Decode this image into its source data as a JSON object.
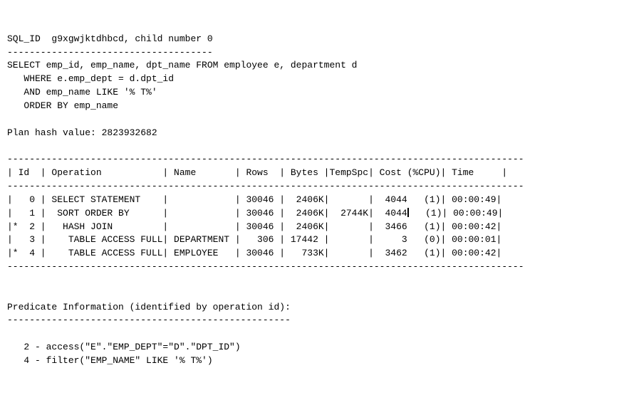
{
  "header": {
    "sql_id_line": "SQL_ID  g9xgwjktdhbcd, child number 0",
    "sep1": "-------------------------------------",
    "stmt_l1": "SELECT emp_id, emp_name, dpt_name FROM employee e, department d",
    "stmt_l2": "   WHERE e.emp_dept = d.dpt_id",
    "stmt_l3": "   AND emp_name LIKE '% T%'",
    "stmt_l4": "   ORDER BY emp_name",
    "plan_hash": "Plan hash value: 2823932682"
  },
  "table": {
    "hr": "---------------------------------------------------------------------------------------------",
    "cols": "| Id  | Operation           | Name       | Rows  | Bytes |TempSpc| Cost (%CPU)| Time     |",
    "r0": "|   0 | SELECT STATEMENT    |            | 30046 |  2406K|       |  4044   (1)| 00:00:49|",
    "r1": "|   1 |  SORT ORDER BY      |            | 30046 |  2406K|  2744K|  4044",
    "r1_tail": "   (1)| 00:00:49|",
    "r2": "|*  2 |   HASH JOIN         |            | 30046 |  2406K|       |  3466   (1)| 00:00:42|",
    "r3": "|   3 |    TABLE ACCESS FULL| DEPARTMENT |   306 | 17442 |       |     3   (0)| 00:00:01|",
    "r4": "|*  4 |    TABLE ACCESS FULL| EMPLOYEE   | 30046 |   733K|       |  3462   (1)| 00:00:42|"
  },
  "predicates": {
    "title": "Predicate Information (identified by operation id):",
    "sep": "---------------------------------------------------",
    "p2": "   2 - access(\"E\".\"EMP_DEPT\"=\"D\".\"DPT_ID\")",
    "p4": "   4 - filter(\"EMP_NAME\" LIKE '% T%')"
  },
  "chart_data": {
    "type": "table",
    "title": "Oracle SQL Execution Plan",
    "sql_id": "g9xgwjktdhbcd",
    "child_number": 0,
    "sql_text": "SELECT emp_id, emp_name, dpt_name FROM employee e, department d WHERE e.emp_dept = d.dpt_id AND emp_name LIKE '% T%' ORDER BY emp_name",
    "plan_hash_value": 2823932682,
    "columns": [
      "Id",
      "Operation",
      "Name",
      "Rows",
      "Bytes",
      "TempSpc",
      "Cost (%CPU)",
      "Time"
    ],
    "rows": [
      {
        "Id": 0,
        "Operation": "SELECT STATEMENT",
        "Name": "",
        "Rows": 30046,
        "Bytes": "2406K",
        "TempSpc": "",
        "Cost": 4044,
        "%CPU": 1,
        "Time": "00:00:49"
      },
      {
        "Id": 1,
        "Operation": "SORT ORDER BY",
        "Name": "",
        "Rows": 30046,
        "Bytes": "2406K",
        "TempSpc": "2744K",
        "Cost": 4044,
        "%CPU": 1,
        "Time": "00:00:49"
      },
      {
        "Id": 2,
        "Operation": "HASH JOIN",
        "Name": "",
        "Rows": 30046,
        "Bytes": "2406K",
        "TempSpc": "",
        "Cost": 3466,
        "%CPU": 1,
        "Time": "00:00:42"
      },
      {
        "Id": 3,
        "Operation": "TABLE ACCESS FULL",
        "Name": "DEPARTMENT",
        "Rows": 306,
        "Bytes": "17442",
        "TempSpc": "",
        "Cost": 3,
        "%CPU": 0,
        "Time": "00:00:01"
      },
      {
        "Id": 4,
        "Operation": "TABLE ACCESS FULL",
        "Name": "EMPLOYEE",
        "Rows": 30046,
        "Bytes": "733K",
        "TempSpc": "",
        "Cost": 3462,
        "%CPU": 1,
        "Time": "00:00:42"
      }
    ],
    "predicate_information": [
      {
        "id": 2,
        "kind": "access",
        "expression": "\"E\".\"EMP_DEPT\"=\"D\".\"DPT_ID\""
      },
      {
        "id": 4,
        "kind": "filter",
        "expression": "\"EMP_NAME\" LIKE '% T%'"
      }
    ]
  }
}
